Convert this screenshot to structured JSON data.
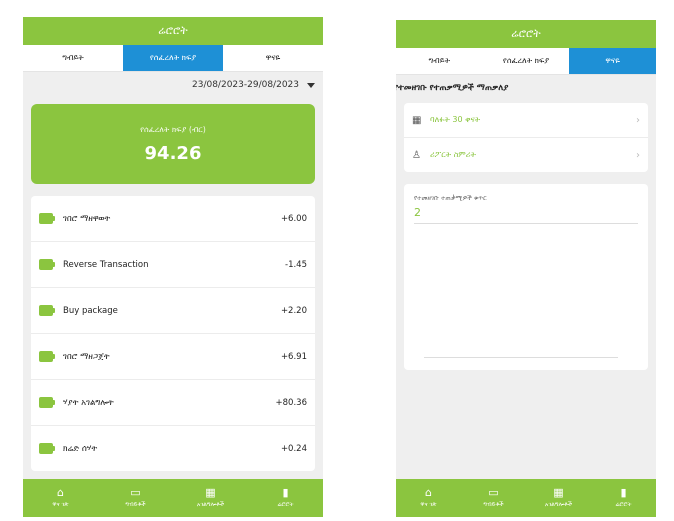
{
  "colors": {
    "accent": "#8bc53f",
    "tab_active": "#1e90d6",
    "background": "#efefef"
  },
  "screen1": {
    "title": "ሬሮሮት",
    "tabs": [
      {
        "label": "ግብይት",
        "active": false
      },
      {
        "label": "የሰፈረለት ክፍያ",
        "active": true
      },
      {
        "label": "ዋናዬ",
        "active": false
      }
    ],
    "date_range": "23/08/2023-29/08/2023",
    "balance": {
      "label": "የሰፈረለት ክፍያ (ብር)",
      "amount": "94.26"
    },
    "transactions": [
      {
        "icon": "wallet-icon",
        "label": "ገበሮ ማዘዋወት",
        "value": "+6.00"
      },
      {
        "icon": "wallet-icon",
        "label": "Reverse Transaction",
        "value": "-1.45"
      },
      {
        "icon": "wallet-icon",
        "label": "Buy package",
        "value": "+2.20"
      },
      {
        "icon": "wallet-icon",
        "label": "ገበሮ ማዘጋጀት",
        "value": "+6.91"
      },
      {
        "icon": "wallet-icon",
        "label": "ሃያት አገልግሎት",
        "value": "+80.36"
      },
      {
        "icon": "wallet-icon",
        "label": "ክሬድ ሰሃት",
        "value": "+0.24"
      }
    ],
    "nav": [
      {
        "icon": "home-icon",
        "label": "ዋና ገጽ"
      },
      {
        "icon": "transaction-icon",
        "label": "ግብይቶች"
      },
      {
        "icon": "services-icon",
        "label": "አገልግሎቶች"
      },
      {
        "icon": "stats-icon",
        "label": "ሬሮሮት"
      }
    ]
  },
  "screen2": {
    "title": "ሬሮሮት",
    "tabs": [
      {
        "label": "ግብይት",
        "active": false
      },
      {
        "label": "የሰፈረለት ክፍያ",
        "active": false
      },
      {
        "label": "ዋናዬ",
        "active": true
      }
    ],
    "section_title": "የተመዘገቡ የተጠቃሚዎች ማጠቃለያ",
    "options": [
      {
        "icon": "calendar-icon",
        "label": "ባለፉት 30 ቀናት"
      },
      {
        "icon": "user-icon",
        "label": "ሪፖርት ስምሪት"
      }
    ],
    "field_label": "የተመዘገቡ ተጠቃሚዎች ቁጥር",
    "field_value": "2",
    "nav": [
      {
        "icon": "home-icon",
        "label": "ዋና ገጽ"
      },
      {
        "icon": "transaction-icon",
        "label": "ግብይቶች"
      },
      {
        "icon": "services-icon",
        "label": "አገልግሎቶች"
      },
      {
        "icon": "stats-icon",
        "label": "ሬሮሮት"
      }
    ]
  }
}
